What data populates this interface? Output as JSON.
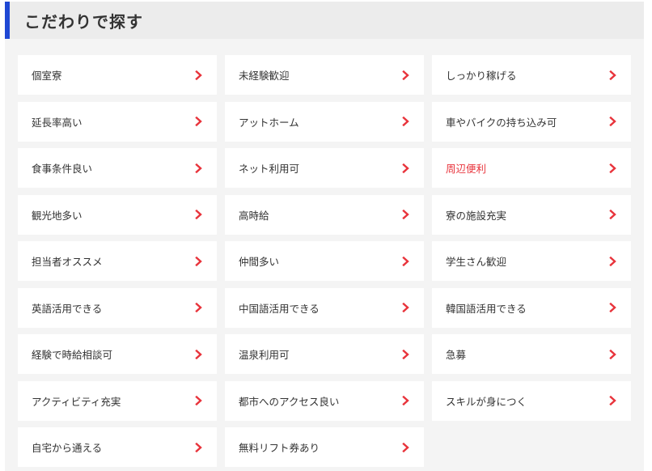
{
  "header": {
    "title": "こだわりで探す"
  },
  "colors": {
    "accent_bar": "#1f48d4",
    "chevron": "#e8333b",
    "active_text": "#e8333b"
  },
  "icons": {
    "chevron": "chevron-right-icon"
  },
  "filters": [
    {
      "label": "個室寮",
      "active": false
    },
    {
      "label": "未経験歓迎",
      "active": false
    },
    {
      "label": "しっかり稼げる",
      "active": false
    },
    {
      "label": "延長率高い",
      "active": false
    },
    {
      "label": "アットホーム",
      "active": false
    },
    {
      "label": "車やバイクの持ち込み可",
      "active": false
    },
    {
      "label": "食事条件良い",
      "active": false
    },
    {
      "label": "ネット利用可",
      "active": false
    },
    {
      "label": "周辺便利",
      "active": true
    },
    {
      "label": "観光地多い",
      "active": false
    },
    {
      "label": "高時給",
      "active": false
    },
    {
      "label": "寮の施設充実",
      "active": false
    },
    {
      "label": "担当者オススメ",
      "active": false
    },
    {
      "label": "仲間多い",
      "active": false
    },
    {
      "label": "学生さん歓迎",
      "active": false
    },
    {
      "label": "英語活用できる",
      "active": false
    },
    {
      "label": "中国語活用できる",
      "active": false
    },
    {
      "label": "韓国語活用できる",
      "active": false
    },
    {
      "label": "経験で時給相談可",
      "active": false
    },
    {
      "label": "温泉利用可",
      "active": false
    },
    {
      "label": "急募",
      "active": false
    },
    {
      "label": "アクティビティ充実",
      "active": false
    },
    {
      "label": "都市へのアクセス良い",
      "active": false
    },
    {
      "label": "スキルが身につく",
      "active": false
    },
    {
      "label": "自宅から通える",
      "active": false
    },
    {
      "label": "無料リフト券あり",
      "active": false
    }
  ]
}
